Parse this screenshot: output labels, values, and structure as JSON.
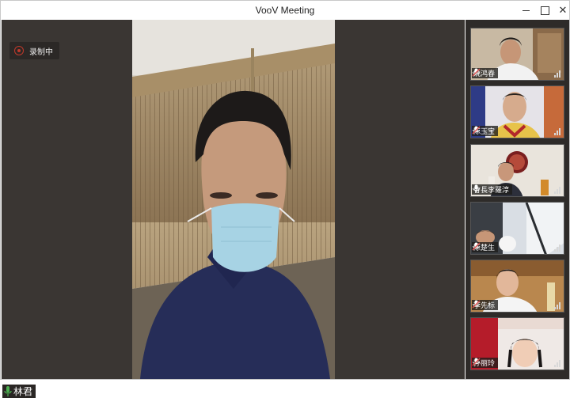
{
  "window": {
    "title": "VooV Meeting"
  },
  "recording": {
    "label": "录制中"
  },
  "active_speaker": {
    "name": "林君",
    "muted": false
  },
  "participants": [
    {
      "name": "姚鸿春",
      "muted": true
    },
    {
      "name": "陈玉宝",
      "muted": true
    },
    {
      "name": "會長李羅淳",
      "muted": false
    },
    {
      "name": "陈楚生",
      "muted": true
    },
    {
      "name": "李先标",
      "muted": true
    },
    {
      "name": "孙丽玲",
      "muted": true
    }
  ],
  "colors": {
    "stage": "#3a3633",
    "sidebar": "#2e2b29",
    "recording": "#c0392b",
    "mic_active": "#4caf50",
    "mic_muted": "#e05050"
  }
}
